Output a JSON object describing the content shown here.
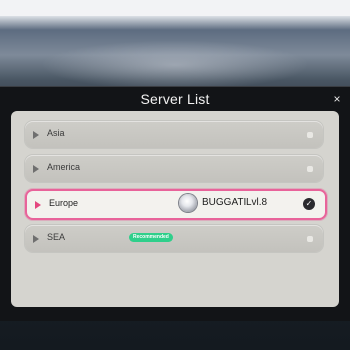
{
  "modal": {
    "title": "Server List",
    "close_symbol": "×"
  },
  "servers": [
    {
      "region": "Asia",
      "status_icon": "status-dot-icon"
    },
    {
      "region": "America",
      "status_icon": "status-dot-icon"
    },
    {
      "region": "Europe",
      "selected": true,
      "player_name": "BUGGATI",
      "player_level": "Lvl.8",
      "status_icon": "check-icon",
      "check_symbol": "✓"
    },
    {
      "region": "SEA",
      "badge": "Recommended",
      "status_icon": "status-dot-icon"
    }
  ],
  "colors": {
    "selected_border": "#e8639a",
    "recommended_badge": "#2fcf8b",
    "panel": "#d5d4cf",
    "modal_bg": "#121417"
  }
}
